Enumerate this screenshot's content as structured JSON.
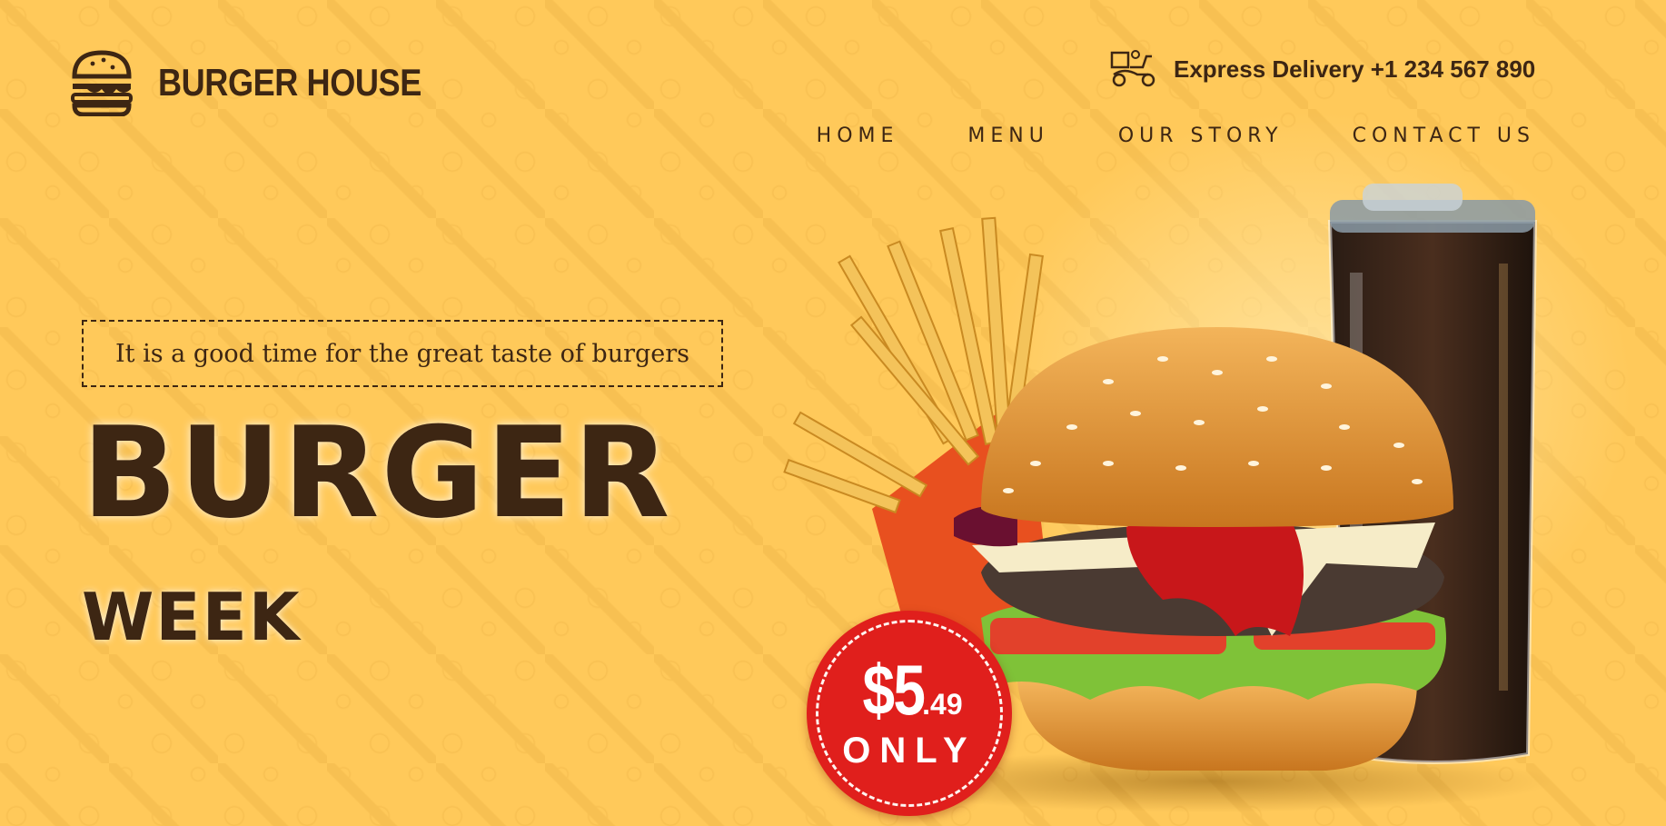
{
  "brand": {
    "name": "BURGER HOUSE",
    "logo_icon": "burger-icon"
  },
  "delivery": {
    "icon": "scooter-delivery-icon",
    "text": "Express Delivery +1 234 567 890"
  },
  "nav": {
    "items": [
      {
        "label": "HOME"
      },
      {
        "label": "MENU"
      },
      {
        "label": "OUR STORY"
      },
      {
        "label": "CONTACT US"
      }
    ]
  },
  "hero": {
    "tagline": "It is a good time for the great taste of burgers",
    "title": "BURGER",
    "subtitle": "WEEK"
  },
  "price_badge": {
    "price_main": "$5",
    "price_cents": ".49",
    "suffix": "ONLY"
  },
  "colors": {
    "background": "#ffc95a",
    "text_dark": "#3d2613",
    "badge_red": "#e01f1c"
  }
}
